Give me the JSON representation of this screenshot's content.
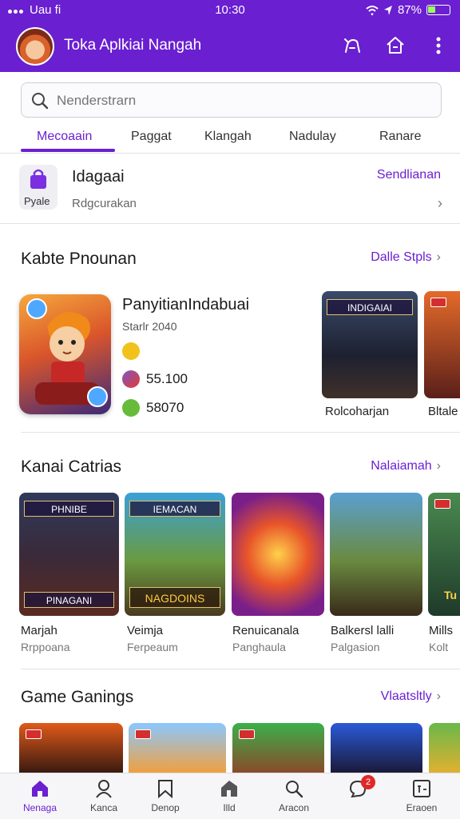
{
  "status_bar": {
    "carrier": "Uau fi",
    "time": "10:30",
    "battery": "87%"
  },
  "header": {
    "title": "Toka Aplkiai Nangah"
  },
  "search": {
    "placeholder": "Nenderstrarn"
  },
  "tabs": [
    "Mecoaain",
    "Paggat",
    "Klangah",
    "Nadulay",
    "Ranare"
  ],
  "promo": {
    "icon_label": "Pyale",
    "title": "Idagaai",
    "subtitle": "Rdgcurakan",
    "link": "Sendlianan"
  },
  "sections": {
    "featured": {
      "title": "Kabte Pnounan",
      "link": "Dalle Stpls"
    },
    "category": {
      "title": "Kanai Catrias",
      "link": "Nalaiamah"
    },
    "games": {
      "title": "Game Ganings",
      "link": "Vlaatsltly"
    }
  },
  "featured_app": {
    "title": "PanyitianIndabuai",
    "subtitle": "Starlr 2040",
    "stat1": "55.100",
    "stat2": "58070",
    "side_cards": [
      {
        "banner": "INDIGAIAI",
        "caption": "Rolcoharjan"
      },
      {
        "banner": "",
        "caption": "Bltale"
      }
    ]
  },
  "category_cards": [
    {
      "banner": "PHNIBE",
      "footer": "PINAGANI",
      "title": "Marjah",
      "sub": "Rrppoana"
    },
    {
      "banner": "IEMACAN",
      "footer": "NAGDOINS",
      "title": "Veimja",
      "sub": "Ferpeaum"
    },
    {
      "banner": "",
      "footer": "",
      "title": "Renuicanala",
      "sub": "Panghaula"
    },
    {
      "banner": "",
      "footer": "",
      "title": "Balkersl lalli",
      "sub": "Palgasion"
    },
    {
      "banner": "",
      "footer": "Tu",
      "title": "Mills",
      "sub": "Kolt"
    }
  ],
  "bottom_nav": [
    {
      "label": "Nenaga",
      "icon": "home-icon"
    },
    {
      "label": "Kanca",
      "icon": "person-icon"
    },
    {
      "label": "Denop",
      "icon": "bookmark-icon"
    },
    {
      "label": "Illd",
      "icon": "tag-icon"
    },
    {
      "label": "Aracon",
      "icon": "search-icon"
    },
    {
      "label": "",
      "icon": "chat-icon",
      "badge": "2"
    },
    {
      "label": "Eraoen",
      "icon": "calendar-icon"
    }
  ],
  "colors": {
    "accent": "#6a1fd1",
    "divider": "#e3e3e8"
  }
}
